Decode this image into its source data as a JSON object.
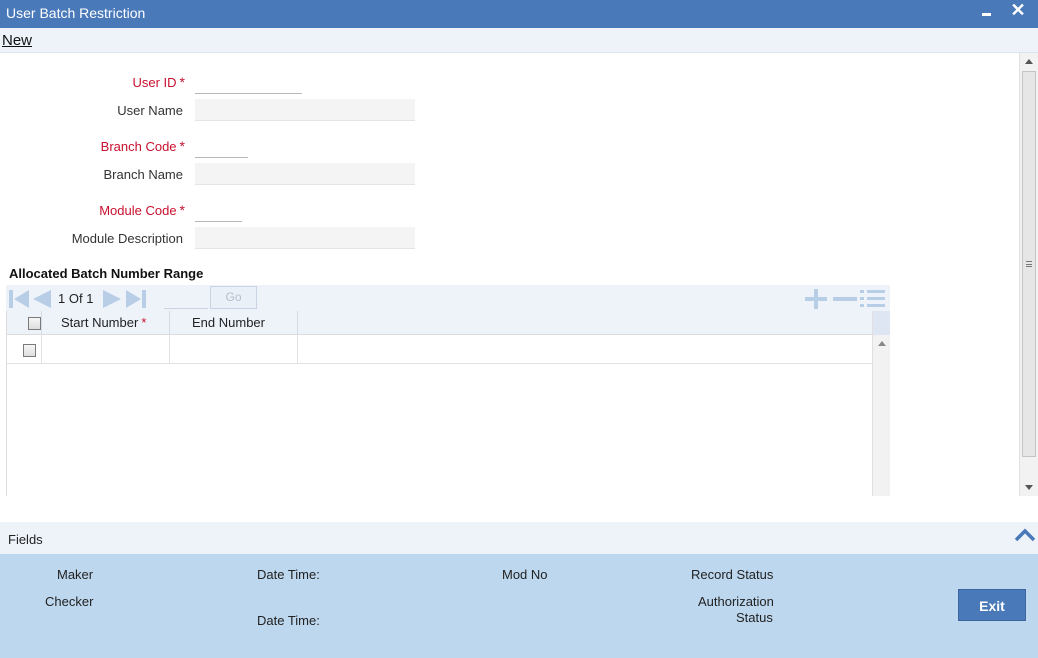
{
  "window": {
    "title": "User Batch Restriction",
    "minimize_icon": "minimize-icon",
    "close_icon": "close-icon"
  },
  "menu": {
    "new_label": "New"
  },
  "form": {
    "user_id_label": "User ID",
    "user_name_label": "User Name",
    "branch_code_label": "Branch Code",
    "branch_name_label": "Branch Name",
    "module_code_label": "Module Code",
    "module_description_label": "Module Description",
    "required_marker": "*",
    "user_id_value": "",
    "user_name_value": "",
    "branch_code_value": "",
    "branch_name_value": "",
    "module_code_value": "",
    "module_description_value": ""
  },
  "batch_section": {
    "title": "Allocated Batch Number Range",
    "pager": {
      "current": "1",
      "of_label": "Of",
      "total": "1",
      "go_label": "Go",
      "page_input": ""
    },
    "columns": [
      {
        "label": "Start Number",
        "required": "*"
      },
      {
        "label": "End Number"
      }
    ],
    "rows": [
      {
        "start_number": "",
        "end_number": ""
      }
    ]
  },
  "fields_bar": {
    "label": "Fields"
  },
  "footer": {
    "maker_label": "Maker",
    "checker_label": "Checker",
    "date_time_label": "Date Time:",
    "mod_no_label": "Mod No",
    "record_status_label": "Record Status",
    "authorization_status_label_1": "Authorization",
    "authorization_status_label_2": "Status",
    "exit_label": "Exit"
  },
  "colors": {
    "title_bar": "#4a79ba",
    "required": "#c8102e",
    "footer": "#bdd7ee",
    "toolbar": "#eef3fa"
  }
}
